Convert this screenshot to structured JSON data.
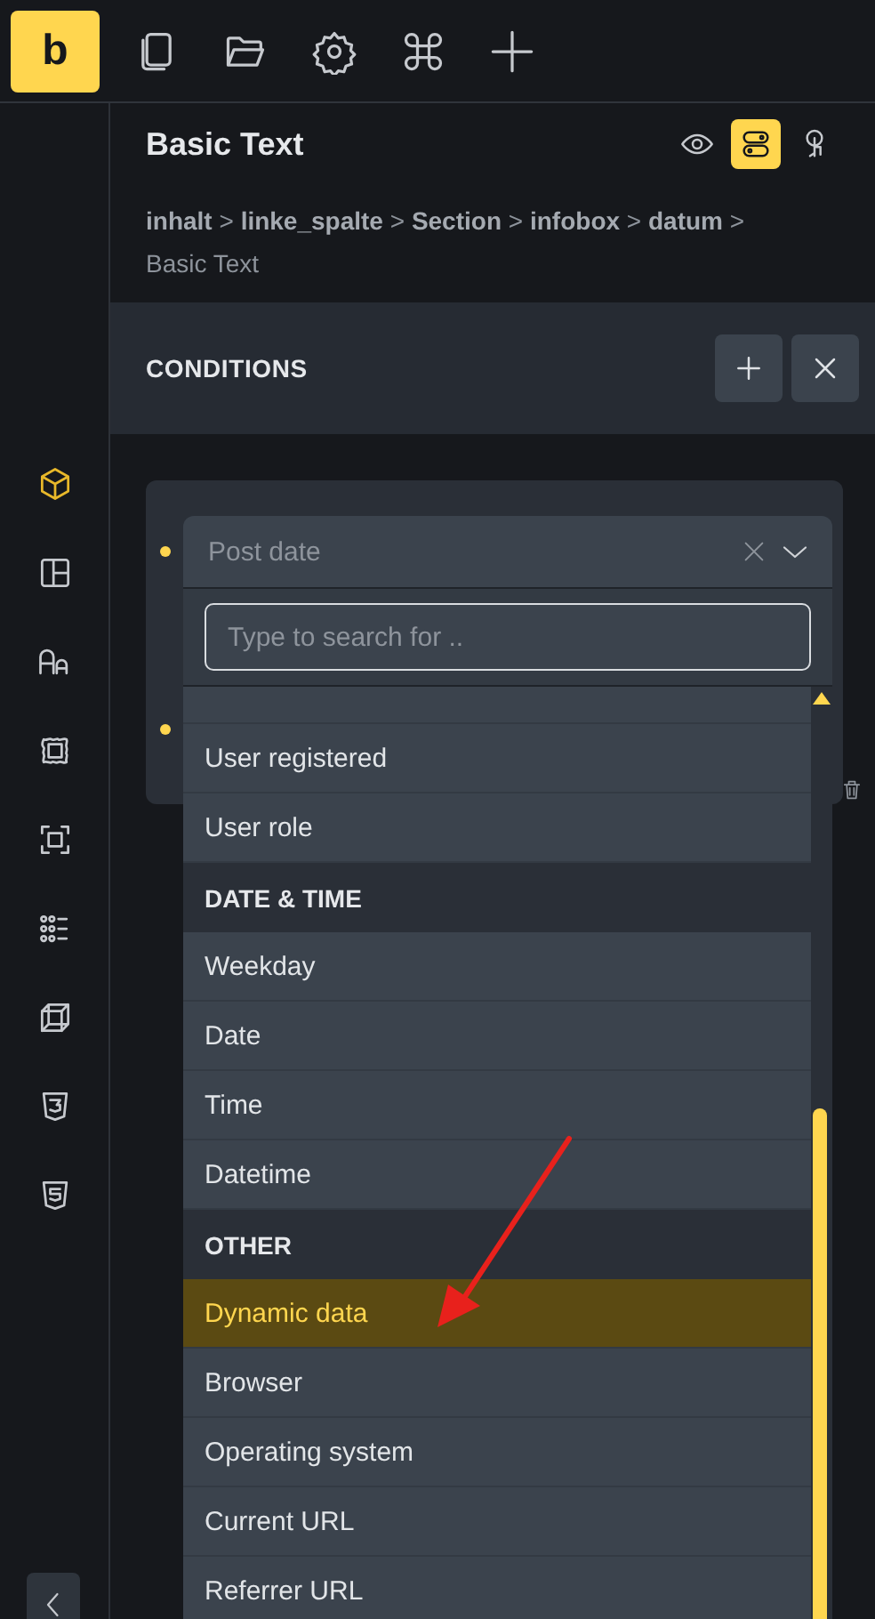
{
  "toolbar": {
    "logo": "b"
  },
  "sidebar": {
    "items": [
      {
        "selected": true
      },
      {
        "selected": false
      },
      {
        "selected": false
      },
      {
        "selected": false
      },
      {
        "selected": false
      },
      {
        "selected": false
      },
      {
        "selected": false
      },
      {
        "selected": false
      },
      {
        "selected": false
      }
    ]
  },
  "panel": {
    "title": "Basic Text",
    "view_buttons": [
      {
        "selected": false
      },
      {
        "selected": true
      },
      {
        "selected": false
      }
    ],
    "breadcrumb": "**inhalt** > **linke_spalte** > **Section** > **infobox** > **datum** > Basic Text"
  },
  "conditions": {
    "title": "CONDITIONS"
  },
  "select": {
    "placeholder": "Post date",
    "search_placeholder": "Type to search for ..",
    "options": [
      {
        "kind": "option",
        "label": "User registered",
        "selected": false
      },
      {
        "kind": "option",
        "label": "User role",
        "selected": false
      },
      {
        "kind": "group",
        "label": "DATE & TIME"
      },
      {
        "kind": "option",
        "label": "Weekday",
        "selected": false
      },
      {
        "kind": "option",
        "label": "Date",
        "selected": false
      },
      {
        "kind": "option",
        "label": "Time",
        "selected": false
      },
      {
        "kind": "option",
        "label": "Datetime",
        "selected": false
      },
      {
        "kind": "group",
        "label": "OTHER"
      },
      {
        "kind": "option",
        "label": "Dynamic data",
        "selected": true
      },
      {
        "kind": "option",
        "label": "Browser",
        "selected": false
      },
      {
        "kind": "option",
        "label": "Operating system",
        "selected": false
      },
      {
        "kind": "option",
        "label": "Current URL",
        "selected": false
      },
      {
        "kind": "option",
        "label": "Referrer URL",
        "selected": false
      }
    ]
  }
}
